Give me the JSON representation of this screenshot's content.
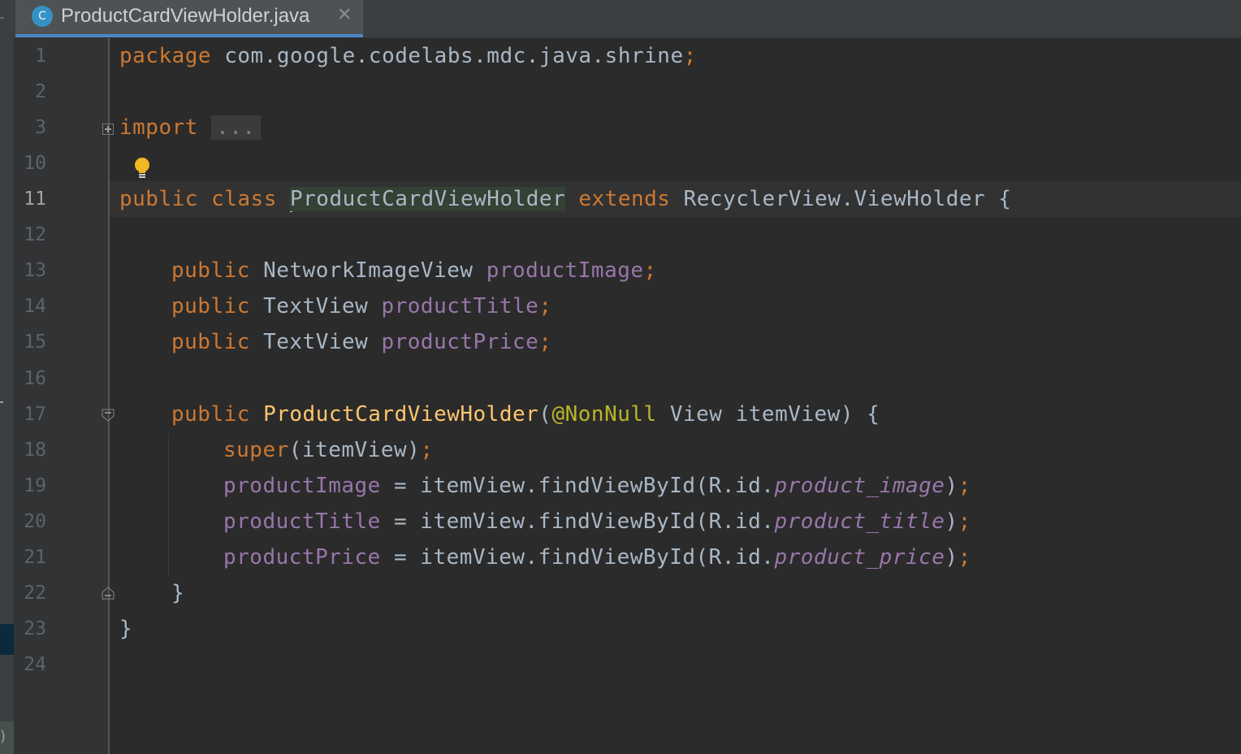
{
  "tab": {
    "file_icon_letter": "C",
    "file_name": "ProductCardViewHolder.java",
    "close_glyph": "✕"
  },
  "left_strip": {
    "top_mark": "-",
    "bottom_mark": ")"
  },
  "editor": {
    "line_numbers": [
      "1",
      "2",
      "3",
      "10",
      "11",
      "12",
      "13",
      "14",
      "15",
      "16",
      "17",
      "18",
      "19",
      "20",
      "21",
      "22",
      "23",
      "24"
    ],
    "current_line": "11",
    "code": {
      "l1_kw": "package",
      "l1_pkg": " com.google.codelabs.mdc.java.shrine",
      "l1_semi": ";",
      "l3_kw": "import",
      "l3_fold": "...",
      "l11_public": "public",
      "l11_class": " class ",
      "l11_name": "ProductCardViewHolder",
      "l11_extends": " extends",
      "l11_rest": " RecyclerView.ViewHolder {",
      "l13_public": "public",
      "l13_type": " NetworkImageView ",
      "l13_field": "productImage",
      "l13_semi": ";",
      "l14_public": "public",
      "l14_type": " TextView ",
      "l14_field": "productTitle",
      "l14_semi": ";",
      "l15_public": "public",
      "l15_type": " TextView ",
      "l15_field": "productPrice",
      "l15_semi": ";",
      "l17_public": "public",
      "l17_method": " ProductCardViewHolder",
      "l17_paren": "(",
      "l17_ann": "@NonNull",
      "l17_rest": " View itemView) {",
      "l18_super": "super",
      "l18_rest": "(itemView)",
      "l18_semi": ";",
      "l19_field": "productImage",
      "l19_mid": " = itemView.findViewById(R.id.",
      "l19_id": "product_image",
      "l19_end": ")",
      "l19_semi": ";",
      "l20_field": "productTitle",
      "l20_mid": " = itemView.findViewById(R.id.",
      "l20_id": "product_title",
      "l20_end": ")",
      "l20_semi": ";",
      "l21_field": "productPrice",
      "l21_mid": " = itemView.findViewById(R.id.",
      "l21_id": "product_price",
      "l21_end": ")",
      "l21_semi": ";",
      "l22_brace": "}",
      "l23_brace": "}"
    }
  },
  "colors": {
    "keyword": "#cc7832",
    "field": "#9876aa",
    "annotation": "#bbb529",
    "method_decl": "#ffc66d",
    "plain": "#a9b7c6",
    "tab_underline": "#4a88c7",
    "file_icon": "#3592c4",
    "bulb": "#f2b824"
  },
  "icons": {
    "file_icon": "java-class-icon",
    "close": "close-icon",
    "bulb": "lightbulb-icon",
    "fold_expand": "fold-expand-icon",
    "fold_start": "fold-start-icon",
    "fold_end": "fold-end-icon"
  }
}
